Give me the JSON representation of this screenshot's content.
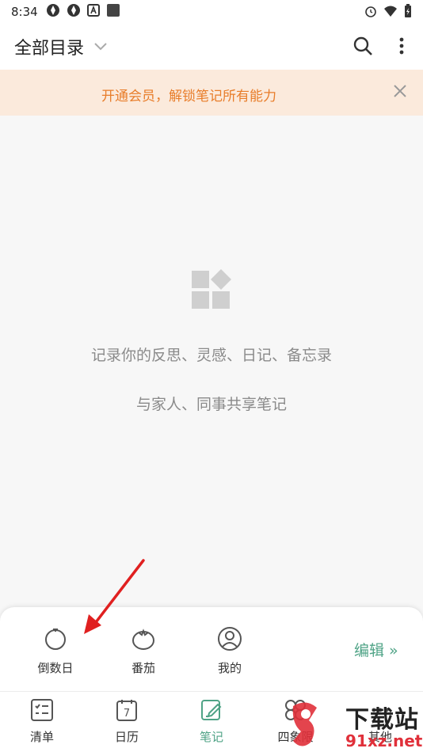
{
  "status_bar": {
    "time": "8:34"
  },
  "header": {
    "title": "全部目录"
  },
  "banner": {
    "text": "开通会员，解锁笔记所有能力"
  },
  "empty_state": {
    "line1": "记录你的反思、灵感、日记、备忘录",
    "line2": "与家人、同事共享笔记"
  },
  "panel": {
    "items": [
      {
        "label": "倒数日",
        "icon": "countdown-icon"
      },
      {
        "label": "番茄",
        "icon": "tomato-icon"
      },
      {
        "label": "我的",
        "icon": "profile-icon"
      }
    ],
    "edit_label": "编辑 »"
  },
  "tabbar": {
    "tabs": [
      {
        "label": "清单",
        "icon": "checklist-icon"
      },
      {
        "label": "日历",
        "icon": "calendar-icon",
        "day": "7"
      },
      {
        "label": "笔记",
        "icon": "note-icon",
        "active": true
      },
      {
        "label": "四象限",
        "icon": "quadrant-icon"
      },
      {
        "label": "其他",
        "icon": "more-icon"
      }
    ]
  },
  "watermark": {
    "big": "下载站",
    "small": "91xz.net"
  },
  "colors": {
    "accent": "#4fa386",
    "banner_bg": "#fbeadc",
    "banner_text": "#e87d2a",
    "arrow": "#e02020"
  }
}
